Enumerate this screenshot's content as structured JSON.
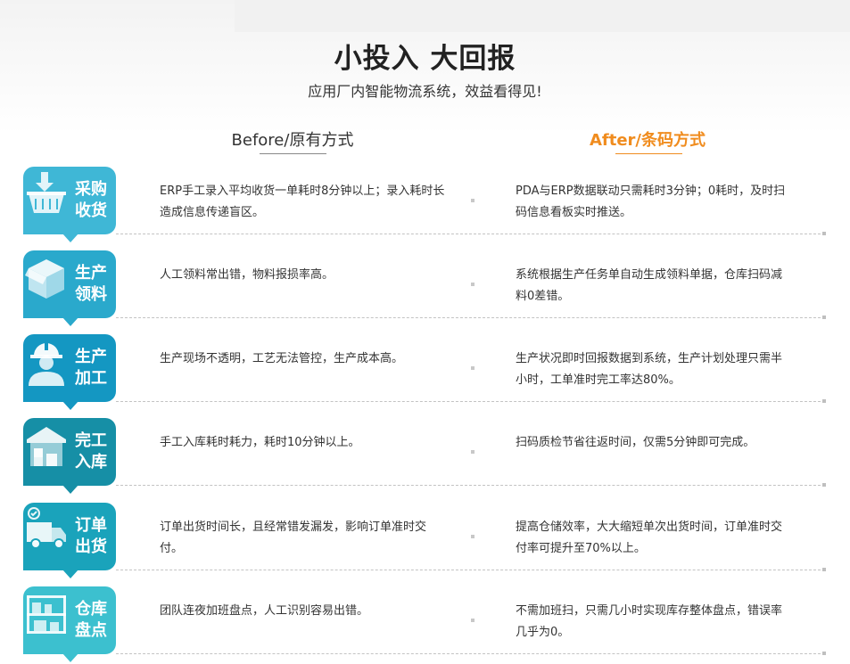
{
  "header": {
    "title": "小投入 大回报",
    "subtitle": "应用厂内智能物流系统，效益看得见!"
  },
  "columns": {
    "before": "Before/原有方式",
    "after": "After/条码方式"
  },
  "colors": {
    "accent_orange": "#f08c1e",
    "row_colors": [
      "#3fb7d6",
      "#2aa9cc",
      "#1497c2",
      "#168fa6",
      "#1aa3bb",
      "#3cc0cf"
    ]
  },
  "rows": [
    {
      "label_line1": "采购",
      "label_line2": "收货",
      "icon": "basket-download-icon",
      "before": "ERP手工录入平均收货一单耗时8分钟以上；录入耗时长造成信息传递盲区。",
      "after": "PDA与ERP数据联动只需耗时3分钟；0耗时，及时扫码信息看板实时推送。"
    },
    {
      "label_line1": "生产",
      "label_line2": "领料",
      "icon": "open-box-icon",
      "before": "人工领料常出错，物料报损率高。",
      "after": "系统根据生产任务单自动生成领料单据，仓库扫码减料0差错。"
    },
    {
      "label_line1": "生产",
      "label_line2": "加工",
      "icon": "worker-helmet-icon",
      "before": "生产现场不透明，工艺无法管控，生产成本高。",
      "after": "生产状况即时回报数据到系统，生产计划处理只需半小时，工单准时完工率达80%。"
    },
    {
      "label_line1": "完工",
      "label_line2": "入库",
      "icon": "warehouse-icon",
      "before": "手工入库耗时耗力，耗时10分钟以上。",
      "after": "扫码质检节省往返时间，仅需5分钟即可完成。"
    },
    {
      "label_line1": "订单",
      "label_line2": "出货",
      "icon": "delivery-truck-icon",
      "before": "订单出货时间长，且经常错发漏发，影响订单准时交付。",
      "after": "提高仓储效率，大大缩短单次出货时间，订单准时交付率可提升至70%以上。"
    },
    {
      "label_line1": "仓库",
      "label_line2": "盘点",
      "icon": "storage-shelf-icon",
      "before": "团队连夜加班盘点，人工识别容易出错。",
      "after": "不需加班扫，只需几小时实现库存整体盘点，错误率几乎为0。"
    }
  ]
}
